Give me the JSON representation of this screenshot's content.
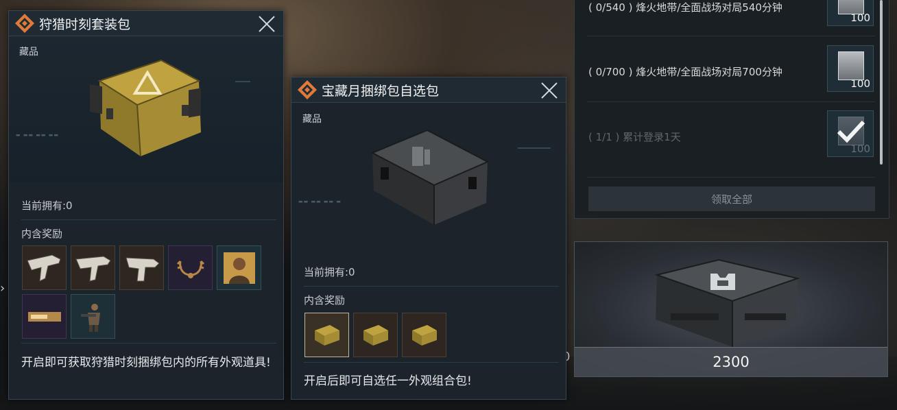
{
  "background": {
    "edge_number": "0",
    "edge_left_glyph": "›"
  },
  "popup_hunt": {
    "title": "狩猎时刻套装包",
    "category": "藏品",
    "owned": "当前拥有:0",
    "rewards_label": "内含奖励",
    "description": "开启即可获取狩猎时刻捆绑包内的所有外观道具!",
    "rewards": [
      "weapon-skin",
      "weapon-skin",
      "weapon-skin",
      "antler-charm",
      "operator-portrait",
      "weapon-skin-banner",
      "operator-figure"
    ]
  },
  "popup_treasure": {
    "title": "宝藏月捆绑包自选包",
    "category": "藏品",
    "owned": "当前拥有:0",
    "rewards_label": "内含奖励",
    "description": "开启后即可自选任一外观组合包!",
    "rewards": [
      "crate",
      "crate",
      "crate"
    ]
  },
  "tasks": {
    "items": [
      {
        "text": "( 0/540 ) 烽火地带/全面战场对局540分钟",
        "reward": "100",
        "done": false
      },
      {
        "text": "( 0/700 ) 烽火地带/全面战场对局700分钟",
        "reward": "100",
        "done": false
      },
      {
        "text": "( 1/1 ) 累计登录1天",
        "reward": "100",
        "done": true
      }
    ],
    "claim_all_label": "领取全部"
  },
  "crate": {
    "price": "2300"
  },
  "colors": {
    "accent_orange": "#e07a3a",
    "panel_bg": "#1b232b",
    "header_bg": "#1f2a33"
  }
}
